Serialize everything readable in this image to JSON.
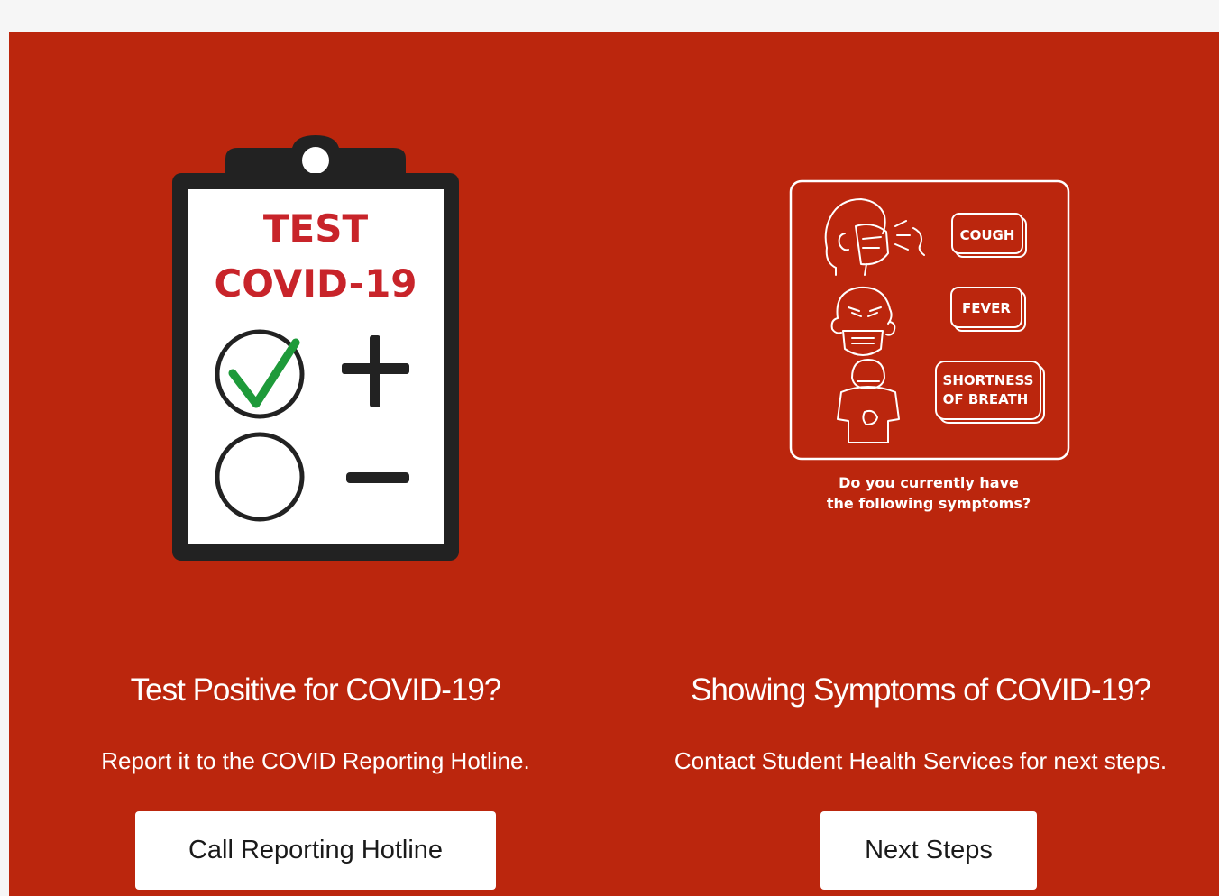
{
  "left_card": {
    "clipboard": {
      "line1": "TEST",
      "line2": "COVID-19"
    },
    "heading": "Test Positive for COVID-19?",
    "description": "Report it to the COVID Reporting Hotline.",
    "button_label": "Call Reporting Hotline"
  },
  "right_card": {
    "symptoms": {
      "cough": "COUGH",
      "fever": "FEVER",
      "shortness_line1": "SHORTNESS",
      "shortness_line2": "OF BREATH",
      "question_line1": "Do you currently have",
      "question_line2": "the following symptoms?"
    },
    "heading": "Showing Symptoms of COVID-19?",
    "description": "Contact Student Health Services for next steps.",
    "button_label": "Next Steps"
  },
  "colors": {
    "panel_background": "#bb260d",
    "page_background": "#f6f6f6",
    "check_green": "#1e9a3a",
    "clipboard_title_red": "#c8242a"
  },
  "icons": [
    "clipboard-test-icon",
    "check-icon",
    "plus-icon",
    "minus-icon",
    "cough-person-icon",
    "fever-person-icon",
    "breathless-person-icon"
  ]
}
